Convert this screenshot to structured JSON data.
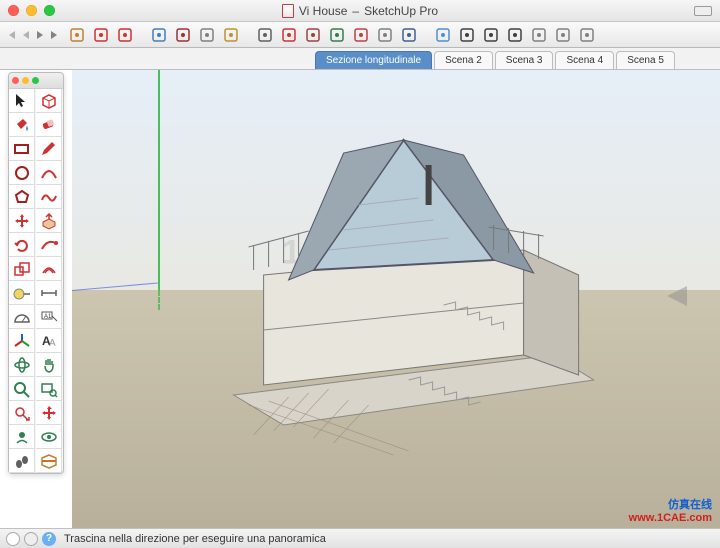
{
  "window": {
    "title_file": "Vi House",
    "title_app": "SketchUp Pro"
  },
  "scenes": {
    "tabs": [
      {
        "label": "Sezione longitudinale",
        "active": true
      },
      {
        "label": "Scena 2",
        "active": false
      },
      {
        "label": "Scena 3",
        "active": false
      },
      {
        "label": "Scena 4",
        "active": false
      },
      {
        "label": "Scena 5",
        "active": false
      }
    ]
  },
  "top_tools": [
    {
      "name": "warehouse-icon",
      "color": "#c08030"
    },
    {
      "name": "component-icon",
      "color": "#d03030"
    },
    {
      "name": "materials-icon",
      "color": "#d03030"
    },
    {
      "name": "styles-icon",
      "color": "#4080c0"
    },
    {
      "name": "layers-icon",
      "color": "#a03030"
    },
    {
      "name": "outliner-icon",
      "color": "#808080"
    },
    {
      "name": "scenes-icon",
      "color": "#c09030"
    },
    {
      "name": "shadows-icon",
      "color": "#606060"
    },
    {
      "name": "fog-icon",
      "color": "#d03030"
    },
    {
      "name": "match-photo-icon",
      "color": "#a04040"
    },
    {
      "name": "soften-icon",
      "color": "#308050"
    },
    {
      "name": "instructor-icon",
      "color": "#c04040"
    },
    {
      "name": "preferences-icon",
      "color": "#808080"
    },
    {
      "name": "extension-icon",
      "color": "#406090"
    },
    {
      "name": "xray-icon",
      "color": "#5090d0"
    },
    {
      "name": "back-icon",
      "color": "#404040"
    },
    {
      "name": "wire-icon",
      "color": "#404040"
    },
    {
      "name": "hidden-icon",
      "color": "#404040"
    },
    {
      "name": "shaded-icon",
      "color": "#808080"
    },
    {
      "name": "shaded-texture-icon",
      "color": "#808080"
    },
    {
      "name": "mono-icon",
      "color": "#808080"
    }
  ],
  "palette": [
    {
      "name": "select-tool",
      "glyph": "cursor",
      "color": "#222"
    },
    {
      "name": "make-component-tool",
      "glyph": "box",
      "color": "#d03030"
    },
    {
      "name": "paint-bucket-tool",
      "glyph": "bucket",
      "color": "#d03030"
    },
    {
      "name": "eraser-tool",
      "glyph": "eraser",
      "color": "#d03030"
    },
    {
      "name": "rectangle-tool",
      "glyph": "rect",
      "color": "#a02020"
    },
    {
      "name": "line-tool",
      "glyph": "pencil",
      "color": "#d03030"
    },
    {
      "name": "circle-tool",
      "glyph": "circle",
      "color": "#a02020"
    },
    {
      "name": "arc-tool",
      "glyph": "arc",
      "color": "#d03030"
    },
    {
      "name": "polygon-tool",
      "glyph": "poly",
      "color": "#a02020"
    },
    {
      "name": "freehand-tool",
      "glyph": "free",
      "color": "#d03030"
    },
    {
      "name": "move-tool",
      "glyph": "move",
      "color": "#d03030"
    },
    {
      "name": "push-pull-tool",
      "glyph": "push",
      "color": "#d03030"
    },
    {
      "name": "rotate-tool",
      "glyph": "rotate",
      "color": "#d03030"
    },
    {
      "name": "follow-me-tool",
      "glyph": "follow",
      "color": "#d03030"
    },
    {
      "name": "scale-tool",
      "glyph": "scale",
      "color": "#d03030"
    },
    {
      "name": "offset-tool",
      "glyph": "offset",
      "color": "#d03030"
    },
    {
      "name": "tape-tool",
      "glyph": "tape",
      "color": "#606060"
    },
    {
      "name": "dimension-tool",
      "glyph": "dim",
      "color": "#606060"
    },
    {
      "name": "protractor-tool",
      "glyph": "prot",
      "color": "#606060"
    },
    {
      "name": "text-tool",
      "glyph": "text",
      "color": "#333"
    },
    {
      "name": "axes-tool",
      "glyph": "axes",
      "color": "#606060"
    },
    {
      "name": "3dtext-tool",
      "glyph": "3dtext",
      "color": "#333"
    },
    {
      "name": "orbit-tool",
      "glyph": "orbit",
      "color": "#308050"
    },
    {
      "name": "pan-tool",
      "glyph": "pan",
      "color": "#308050"
    },
    {
      "name": "zoom-tool",
      "glyph": "zoom",
      "color": "#308050"
    },
    {
      "name": "zoom-window-tool",
      "glyph": "zoomwin",
      "color": "#308050"
    },
    {
      "name": "previous-tool",
      "glyph": "prev",
      "color": "#d03030"
    },
    {
      "name": "next-tool",
      "glyph": "next",
      "color": "#d03030"
    },
    {
      "name": "position-camera-tool",
      "glyph": "poscam",
      "color": "#308050"
    },
    {
      "name": "look-around-tool",
      "glyph": "look",
      "color": "#308050"
    },
    {
      "name": "walk-tool",
      "glyph": "walk",
      "color": "#606060"
    },
    {
      "name": "section-plane-tool",
      "glyph": "section",
      "color": "#c08030"
    }
  ],
  "status": {
    "hint": "Trascina nella direzione per eseguire una panoramica"
  },
  "viewport_watermark": "1CAE",
  "footer": {
    "cn_text": "仿真在线",
    "url_text": "www.1CAE.com"
  }
}
